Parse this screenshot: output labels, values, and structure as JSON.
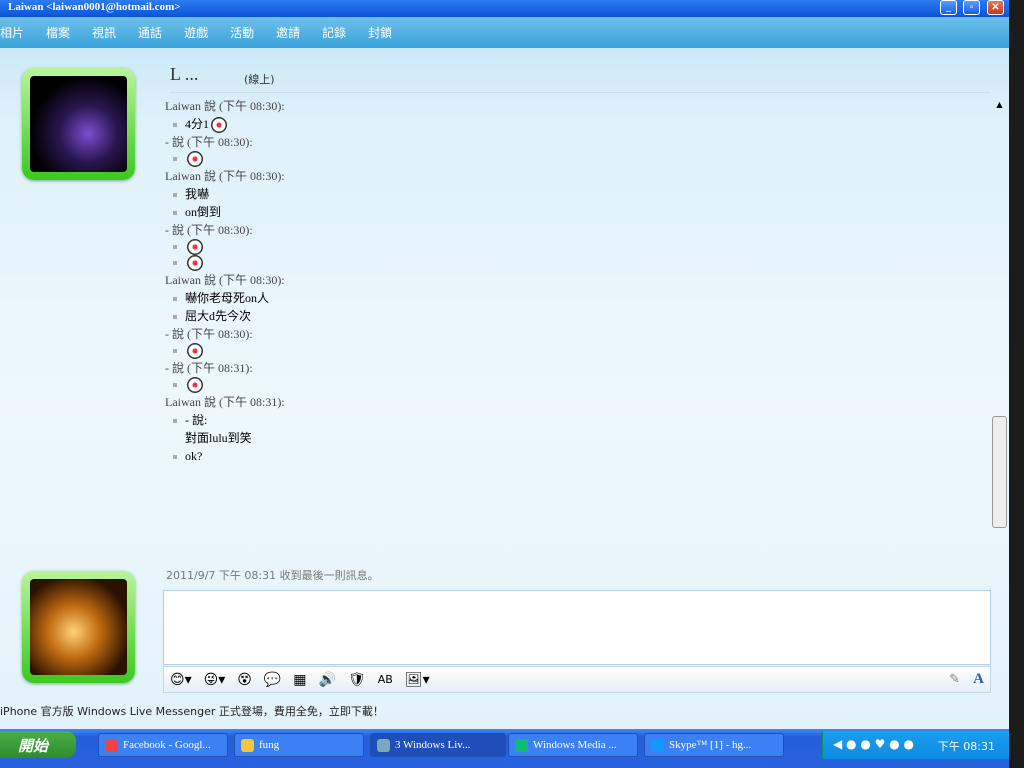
{
  "window": {
    "title": "Laiwan <laiwan0001@hotmail.com>"
  },
  "menu": [
    "相片",
    "檔案",
    "視訊",
    "通話",
    "遊戲",
    "活動",
    "邀請",
    "記錄",
    "封鎖"
  ],
  "contact": {
    "name": "L ...",
    "status": "(線上)"
  },
  "messages": [
    {
      "header": "Laiwan 說 (下午 08:30):",
      "items": [
        {
          "text": "4分1",
          "emoticon": true
        }
      ]
    },
    {
      "header": "- 說 (下午 08:30):",
      "items": [
        {
          "text": "",
          "emoticon": true
        }
      ]
    },
    {
      "header": "Laiwan 說 (下午 08:30):",
      "items": [
        {
          "text": "我嚇",
          "emoticon": false
        },
        {
          "text": "on倒到",
          "emoticon": false
        }
      ]
    },
    {
      "header": "- 說 (下午 08:30):",
      "items": [
        {
          "text": "",
          "emoticon": true
        },
        {
          "text": "",
          "emoticon": true
        }
      ]
    },
    {
      "header": "Laiwan 說 (下午 08:30):",
      "items": [
        {
          "text": "嚇你老母死on人",
          "emoticon": false
        },
        {
          "text": "屈大d先今次",
          "emoticon": false
        }
      ]
    },
    {
      "header": "- 說 (下午 08:30):",
      "items": [
        {
          "text": "",
          "emoticon": true
        }
      ]
    },
    {
      "header": "- 說 (下午 08:31):",
      "items": [
        {
          "text": "",
          "emoticon": true
        }
      ]
    },
    {
      "header": "Laiwan 說 (下午 08:31):",
      "items": [
        {
          "text": "- 說:",
          "emoticon": false
        },
        {
          "text": "對面lulu到笑",
          "emoticon": false,
          "nobullet": true
        },
        {
          "text": "ok?",
          "emoticon": false
        }
      ]
    }
  ],
  "last_message": "2011/9/7 下午 08:31 收到最後一則訊息。",
  "toolbar": [
    "emoticon-icon",
    "wink-icon",
    "nudge-icon",
    "voice-clip-icon",
    "backgrounds-icon",
    "sounds-icon",
    "games-icon",
    "font-icon",
    "share-icon"
  ],
  "ad": "iPhone 官方版 Windows Live Messenger 正式登場，費用全免，立即下載！",
  "taskbar": {
    "start": "開始",
    "tasks": [
      "Facebook - Googl...",
      "fung",
      "3 Windows Liv...",
      "Windows Media ...",
      "Skype™ [1] - hg..."
    ],
    "clock": "下午 08:31"
  }
}
